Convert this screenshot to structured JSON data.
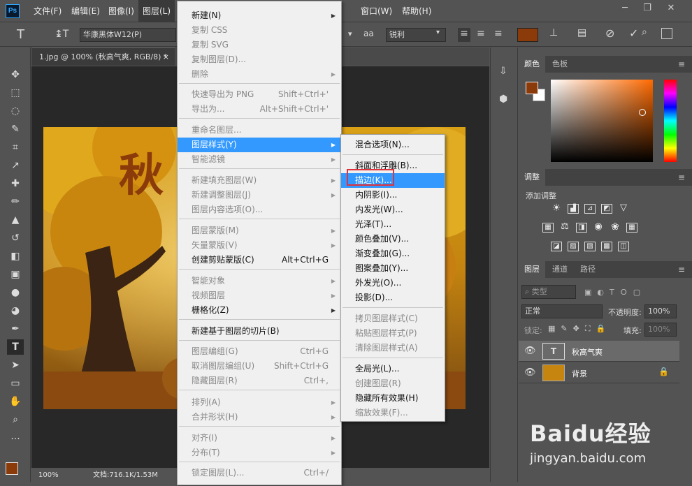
{
  "colors": {
    "foreground": "#8b3a0a",
    "highlight": "#3399ff",
    "callout": "#e0323c"
  },
  "menubar": {
    "logo": "Ps",
    "items": [
      "文件(F)",
      "编辑(E)",
      "图像(I)",
      "图层(L)",
      "窗口(W)",
      "帮助(H)"
    ]
  },
  "options": {
    "font_family": "华康黑体W12(P)",
    "antialias": "锐利",
    "aa_icon": "aa"
  },
  "document": {
    "tab_title": "1.jpg @ 100% (秋高气爽, RGB/8) *",
    "zoom": "100%",
    "doc_info": "文档:716.1K/1.53M",
    "canvas_text": "秋"
  },
  "layer_menu": {
    "items": [
      {
        "label": "新建(N)",
        "shortcut": "",
        "arrow": true,
        "disabled": false
      },
      {
        "label": "复制 CSS",
        "shortcut": "",
        "arrow": false,
        "disabled": true
      },
      {
        "label": "复制 SVG",
        "shortcut": "",
        "arrow": false,
        "disabled": true
      },
      {
        "label": "复制图层(D)...",
        "shortcut": "",
        "arrow": false,
        "disabled": true
      },
      {
        "label": "删除",
        "shortcut": "",
        "arrow": true,
        "disabled": true
      },
      {
        "label": "快速导出为 PNG",
        "shortcut": "Shift+Ctrl+'",
        "arrow": false,
        "disabled": true
      },
      {
        "label": "导出为...",
        "shortcut": "Alt+Shift+Ctrl+'",
        "arrow": false,
        "disabled": true
      },
      {
        "label": "重命名图层...",
        "shortcut": "",
        "arrow": false,
        "disabled": true
      },
      {
        "label": "图层样式(Y)",
        "shortcut": "",
        "arrow": true,
        "disabled": false
      },
      {
        "label": "智能滤镜",
        "shortcut": "",
        "arrow": true,
        "disabled": true
      },
      {
        "label": "新建填充图层(W)",
        "shortcut": "",
        "arrow": true,
        "disabled": true
      },
      {
        "label": "新建调整图层(J)",
        "shortcut": "",
        "arrow": true,
        "disabled": true
      },
      {
        "label": "图层内容选项(O)...",
        "shortcut": "",
        "arrow": false,
        "disabled": true
      },
      {
        "label": "图层蒙版(M)",
        "shortcut": "",
        "arrow": true,
        "disabled": true
      },
      {
        "label": "矢量蒙版(V)",
        "shortcut": "",
        "arrow": true,
        "disabled": true
      },
      {
        "label": "创建剪贴蒙版(C)",
        "shortcut": "Alt+Ctrl+G",
        "arrow": false,
        "disabled": false
      },
      {
        "label": "智能对象",
        "shortcut": "",
        "arrow": true,
        "disabled": true
      },
      {
        "label": "视频图层",
        "shortcut": "",
        "arrow": true,
        "disabled": true
      },
      {
        "label": "栅格化(Z)",
        "shortcut": "",
        "arrow": true,
        "disabled": false
      },
      {
        "label": "新建基于图层的切片(B)",
        "shortcut": "",
        "arrow": false,
        "disabled": false
      },
      {
        "label": "图层编组(G)",
        "shortcut": "Ctrl+G",
        "arrow": false,
        "disabled": true
      },
      {
        "label": "取消图层编组(U)",
        "shortcut": "Shift+Ctrl+G",
        "arrow": false,
        "disabled": true
      },
      {
        "label": "隐藏图层(R)",
        "shortcut": "Ctrl+,",
        "arrow": false,
        "disabled": true
      },
      {
        "label": "排列(A)",
        "shortcut": "",
        "arrow": true,
        "disabled": true
      },
      {
        "label": "合并形状(H)",
        "shortcut": "",
        "arrow": true,
        "disabled": true
      },
      {
        "label": "对齐(I)",
        "shortcut": "",
        "arrow": true,
        "disabled": true
      },
      {
        "label": "分布(T)",
        "shortcut": "",
        "arrow": true,
        "disabled": true
      },
      {
        "label": "锁定图层(L)...",
        "shortcut": "Ctrl+/",
        "arrow": false,
        "disabled": true
      }
    ]
  },
  "style_menu": {
    "items": [
      {
        "label": "混合选项(N)...",
        "disabled": false
      },
      {
        "label": "斜面和浮雕(B)...",
        "disabled": false
      },
      {
        "label": "描边(K)...",
        "disabled": false
      },
      {
        "label": "内阴影(I)...",
        "disabled": false
      },
      {
        "label": "内发光(W)...",
        "disabled": false
      },
      {
        "label": "光泽(T)...",
        "disabled": false
      },
      {
        "label": "颜色叠加(V)...",
        "disabled": false
      },
      {
        "label": "渐变叠加(G)...",
        "disabled": false
      },
      {
        "label": "图案叠加(Y)...",
        "disabled": false
      },
      {
        "label": "外发光(O)...",
        "disabled": false
      },
      {
        "label": "投影(D)...",
        "disabled": false
      },
      {
        "label": "拷贝图层样式(C)",
        "disabled": true
      },
      {
        "label": "粘贴图层样式(P)",
        "disabled": true
      },
      {
        "label": "清除图层样式(A)",
        "disabled": true
      },
      {
        "label": "全局光(L)...",
        "disabled": false
      },
      {
        "label": "创建图层(R)",
        "disabled": true
      },
      {
        "label": "隐藏所有效果(H)",
        "disabled": false
      },
      {
        "label": "缩放效果(F)...",
        "disabled": true
      }
    ]
  },
  "panels": {
    "color_tabs": [
      "颜色",
      "色板"
    ],
    "adjust_tab": "调整",
    "adjust_hint": "添加调整",
    "layers_tabs": [
      "图层",
      "通道",
      "路径"
    ],
    "filter_kind": "类型",
    "blend_mode": "正常",
    "opacity_label": "不透明度:",
    "opacity_value": "100%",
    "lock_label": "锁定:",
    "fill_label": "填充:",
    "fill_value": "100%",
    "layers": [
      {
        "name": "秋高气爽",
        "type": "text",
        "thumb_glyph": "T"
      },
      {
        "name": "背景",
        "type": "image"
      }
    ]
  },
  "watermark": {
    "brand": "Baidu经验",
    "url": "jingyan.baidu.com"
  }
}
